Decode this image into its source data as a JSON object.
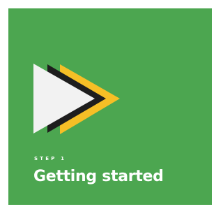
{
  "card": {
    "step_label": "STEP 1",
    "title": "Getting started",
    "background_color": "#4ca650",
    "icon": "play-triangles-icon"
  },
  "colors": {
    "triangle_front": "#f2f2f2",
    "triangle_middle": "#1e1e1e",
    "triangle_back": "#f6bf26",
    "text": "#ffffff"
  }
}
